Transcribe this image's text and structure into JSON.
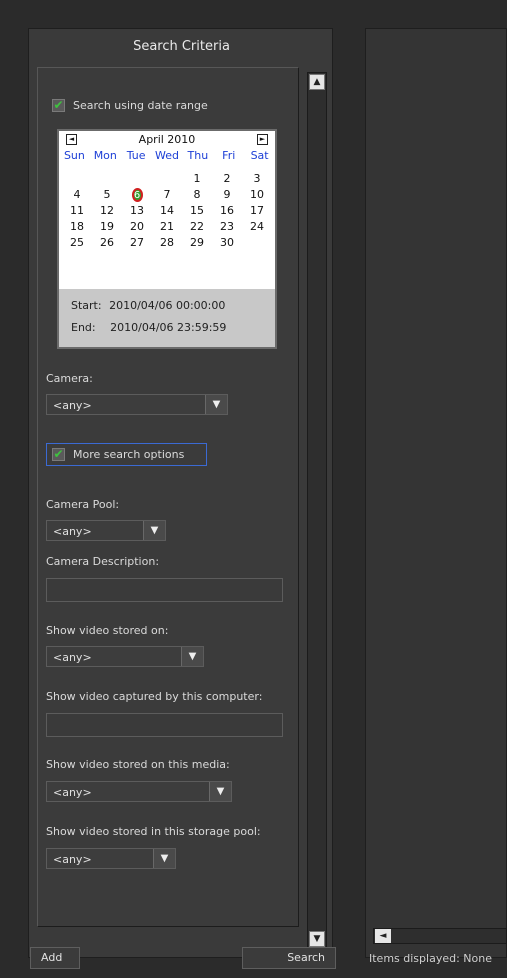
{
  "panel": {
    "title": "Search Criteria"
  },
  "date_range": {
    "label": "Search using date range",
    "checked": true,
    "calendar": {
      "month_label": "April 2010",
      "weekdays": [
        "Sun",
        "Mon",
        "Tue",
        "Wed",
        "Thu",
        "Fri",
        "Sat"
      ],
      "weeks": [
        [
          "",
          "",
          "",
          "",
          "1",
          "2",
          "3"
        ],
        [
          "4",
          "5",
          "6",
          "7",
          "8",
          "9",
          "10"
        ],
        [
          "11",
          "12",
          "13",
          "14",
          "15",
          "16",
          "17"
        ],
        [
          "18",
          "19",
          "20",
          "21",
          "22",
          "23",
          "24"
        ],
        [
          "25",
          "26",
          "27",
          "28",
          "29",
          "30",
          ""
        ]
      ],
      "selected_day": "6",
      "start_label": "Start:",
      "start_value": "2010/04/06  00:00:00",
      "end_label": "End:",
      "end_value": "2010/04/06  23:59:59"
    }
  },
  "camera": {
    "label": "Camera:",
    "value": "<any>"
  },
  "more_options": {
    "label": "More search options",
    "checked": true
  },
  "camera_pool": {
    "label": "Camera Pool:",
    "value": "<any>"
  },
  "camera_description": {
    "label": "Camera Description:",
    "value": ""
  },
  "stored_on": {
    "label": "Show video stored on:",
    "value": "<any>"
  },
  "captured_by": {
    "label": "Show video captured by this computer:",
    "value": ""
  },
  "stored_on_media": {
    "label": "Show video stored on this media:",
    "value": "<any>"
  },
  "storage_pool": {
    "label": "Show video stored in this storage pool:",
    "value": "<any>"
  },
  "buttons": {
    "add": "Add",
    "search": "Search"
  },
  "status": {
    "items_displayed": "Items displayed: None"
  },
  "icons": {
    "check": "✔",
    "dropdown": "▼",
    "scroll_up": "▲",
    "scroll_down": "▼",
    "scroll_left": "◄",
    "prev_month": "◄",
    "next_month": "►"
  },
  "colors": {
    "check": "#3fc23f",
    "weekday": "#1d3fd6",
    "focus_border": "#3b6ad4"
  }
}
